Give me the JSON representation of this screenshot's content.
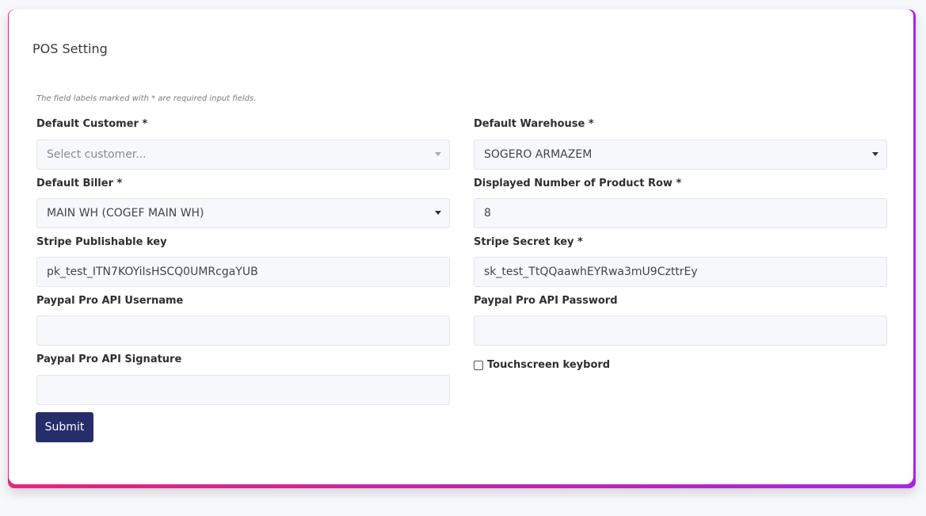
{
  "page": {
    "title": "POS Setting",
    "required_note": "The field labels marked with * are required input fields."
  },
  "form": {
    "default_customer": {
      "label": "Default Customer *",
      "placeholder": "Select customer..."
    },
    "default_warehouse": {
      "label": "Default Warehouse *",
      "value": "SOGERO ARMAZEM"
    },
    "default_biller": {
      "label": "Default Biller *",
      "value": "MAIN WH (COGEF MAIN WH)"
    },
    "product_rows": {
      "label": "Displayed Number of Product Row *",
      "value": "8"
    },
    "stripe_publishable": {
      "label": "Stripe Publishable key",
      "value": "pk_test_ITN7KOYiIsHSCQ0UMRcgaYUB"
    },
    "stripe_secret": {
      "label": "Stripe Secret key *",
      "value": "sk_test_TtQQaawhEYRwa3mU9CzttrEy"
    },
    "paypal_username": {
      "label": "Paypal Pro API Username",
      "value": ""
    },
    "paypal_password": {
      "label": "Paypal Pro API Password",
      "value": ""
    },
    "paypal_signature": {
      "label": "Paypal Pro API Signature",
      "value": ""
    },
    "touchscreen": {
      "label": "Touchscreen keybord",
      "checked": false
    },
    "submit_label": "Submit"
  },
  "colors": {
    "accent_gradient_start": "#e0287c",
    "accent_gradient_end": "#a727e0",
    "submit_button": "#252e6b"
  }
}
